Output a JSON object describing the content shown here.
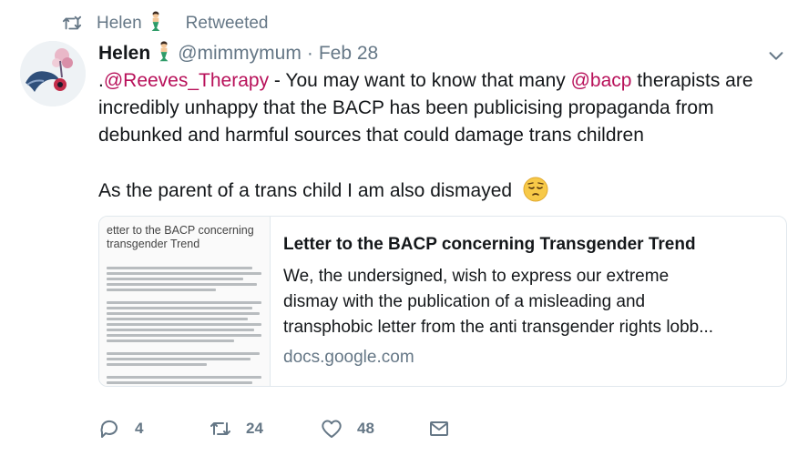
{
  "retweet_context": {
    "name": "Helen",
    "label": "Retweeted"
  },
  "tweet": {
    "display_name": "Helen",
    "handle": "@mimmymum",
    "separator": "·",
    "date": "Feb 28",
    "text_line1_prefix": ".",
    "mention1": "@Reeves_Therapy",
    "text_line1_mid": " - You may want to know that many ",
    "mention2": "@bacp",
    "text_line1_suffix": " therapists are",
    "text_line2": "incredibly unhappy that the BACP has been publicising propaganda from",
    "text_line3": "debunked and harmful sources that could damage trans children",
    "text_line4": "As the parent of a trans child I am also dismayed"
  },
  "card": {
    "thumb_title": "etter to the BACP concerning\ntransgender Trend",
    "title": "Letter to the BACP concerning Transgender Trend",
    "desc_line1": "We, the undersigned, wish to express our extreme",
    "desc_line2": "dismay with the publication of a misleading and",
    "desc_line3": "transphobic letter from the anti transgender rights lobb...",
    "domain": "docs.google.com"
  },
  "actions": {
    "reply_count": "4",
    "retweet_count": "24",
    "like_count": "48"
  },
  "icons": {
    "retweet": "retweet-icon",
    "reply": "reply-icon",
    "like": "heart-icon",
    "message": "envelope-icon",
    "menu": "chevron-down-icon",
    "emoji_name": "mermaid-emoji",
    "emoji_text": "pensive-face-emoji"
  },
  "colors": {
    "mention": "#b8115a",
    "secondary": "#657786",
    "border": "#e1e8ed",
    "text": "#14171a"
  }
}
